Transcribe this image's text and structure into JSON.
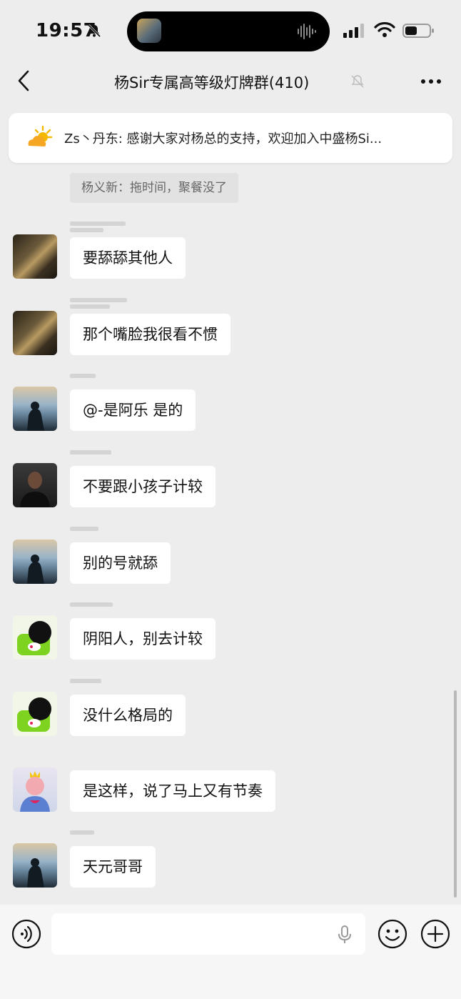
{
  "status_bar": {
    "time": "19:57"
  },
  "nav": {
    "title": "杨Sir专属高等级灯牌群(410)"
  },
  "notice": {
    "text": "Zs丶丹东: 感谢大家对杨总的支持，欢迎加入中盛杨Si..."
  },
  "quote": {
    "text": "杨义新：拖时间，聚餐没了"
  },
  "messages": [
    {
      "text": "要舔舔其他人",
      "avatar": "dark-photo"
    },
    {
      "text": "那个嘴脸我很看不惯",
      "avatar": "dark-photo"
    },
    {
      "text": "@-是阿乐  是的",
      "avatar": "sea-photo"
    },
    {
      "text": "不要跟小孩子计较",
      "avatar": "man-photo"
    },
    {
      "text": "别的号就舔",
      "avatar": "sea-photo"
    },
    {
      "text": "阴阳人，别去计较",
      "avatar": "cartoon-green"
    },
    {
      "text": "没什么格局的",
      "avatar": "cartoon-green"
    },
    {
      "text": "是这样，说了马上又有节奏",
      "avatar": "cartoon-pink"
    },
    {
      "text": "天元哥哥",
      "avatar": "sea-photo"
    }
  ],
  "colors": {
    "background": "#ededed",
    "bubble": "#ffffff",
    "input_bar": "#f6f6f6"
  }
}
